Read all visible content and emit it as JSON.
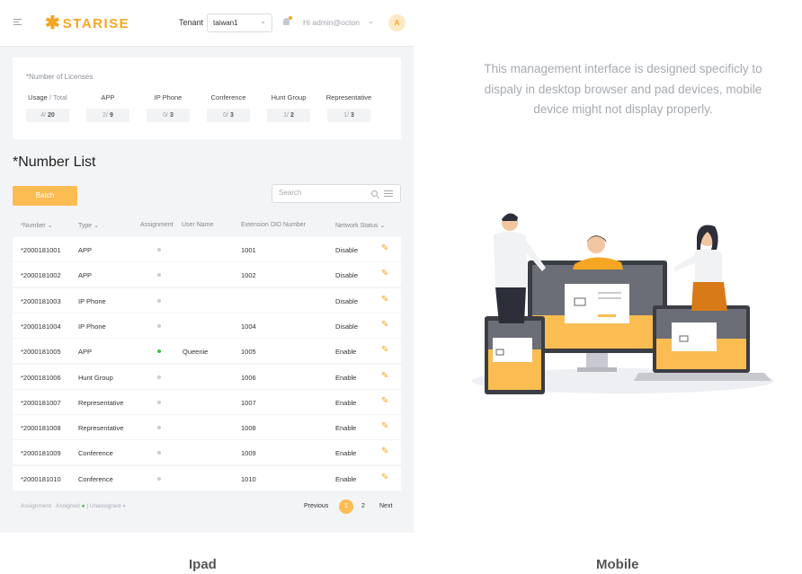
{
  "header": {
    "logo_text": "STARISE",
    "tenant_label": "Tenant",
    "tenant_value": "taiwan1",
    "greeting": "Hi admin@octon",
    "avatar_letter": "A"
  },
  "licenses": {
    "title": "*Number of Licenses",
    "columns": [
      {
        "label": "Usage",
        "sublabel": "/ Total",
        "used": "4/",
        "total": "20"
      },
      {
        "label": "APP",
        "sublabel": "",
        "used": "2/",
        "total": "9"
      },
      {
        "label": "IP Phone",
        "sublabel": "",
        "used": "0/",
        "total": "3"
      },
      {
        "label": "Conference",
        "sublabel": "",
        "used": "0/",
        "total": "3"
      },
      {
        "label": "Hunt Group",
        "sublabel": "",
        "used": "1/",
        "total": "2"
      },
      {
        "label": "Representative",
        "sublabel": "",
        "used": "1/",
        "total": "3"
      }
    ]
  },
  "number_list": {
    "title": "*Number List",
    "batch_label": "Batch",
    "search_placeholder": "Search",
    "headers": {
      "number": "*Number",
      "type": "Type",
      "assignment": "Assignment",
      "user_name": "User Name",
      "extension": "Extension",
      "did": "DID Number",
      "network": "Network Status"
    },
    "rows": [
      {
        "number": "*2000181001",
        "type": "APP",
        "assigned": false,
        "user": "",
        "ext": "1001",
        "status": "Disable"
      },
      {
        "number": "*2000181002",
        "type": "APP",
        "assigned": false,
        "user": "",
        "ext": "1002",
        "status": "Disable"
      },
      {
        "number": "*2000181003",
        "type": "IP Phone",
        "assigned": false,
        "user": "",
        "ext": "",
        "status": "Disable"
      },
      {
        "number": "*2000181004",
        "type": "IP Phone",
        "assigned": false,
        "user": "",
        "ext": "1004",
        "status": "Disable"
      },
      {
        "number": "*2000181005",
        "type": "APP",
        "assigned": true,
        "user": "Queenie",
        "ext": "1005",
        "status": "Enable"
      },
      {
        "number": "*2000181006",
        "type": "Hunt Group",
        "assigned": false,
        "user": "",
        "ext": "1006",
        "status": "Enable"
      },
      {
        "number": "*2000181007",
        "type": "Representative",
        "assigned": false,
        "user": "",
        "ext": "1007",
        "status": "Enable"
      },
      {
        "number": "*2000181008",
        "type": "Representative",
        "assigned": false,
        "user": "",
        "ext": "1008",
        "status": "Enable"
      },
      {
        "number": "*2000181009",
        "type": "Conference",
        "assigned": false,
        "user": "",
        "ext": "1009",
        "status": "Enable"
      },
      {
        "number": "*2000181010",
        "type": "Conference",
        "assigned": false,
        "user": "",
        "ext": "1010",
        "status": "Enable"
      }
    ]
  },
  "legend": {
    "label": "Assignment",
    "assigned": "Assigned",
    "separator": "|",
    "unassigned": "Unassigned"
  },
  "pagination": {
    "previous": "Previous",
    "page1": "1",
    "page2": "2",
    "next": "Next"
  },
  "mobile_note": "This management interface is designed specificly to dispaly in desktop browser and pad devices, mobile device might not display properly.",
  "labels": {
    "ipad": "Ipad",
    "mobile": "Mobile"
  },
  "colors": {
    "accent": "#fbbc52",
    "brand": "#f5a623",
    "assigned_dot": "#3ec43e",
    "unassigned_dot": "#c9ccd2"
  },
  "icons": [
    "menu-icon",
    "bell-icon",
    "chevron-down-icon",
    "search-icon",
    "filter-icon",
    "edit-pencil-icon",
    "status-dot-icon"
  ]
}
